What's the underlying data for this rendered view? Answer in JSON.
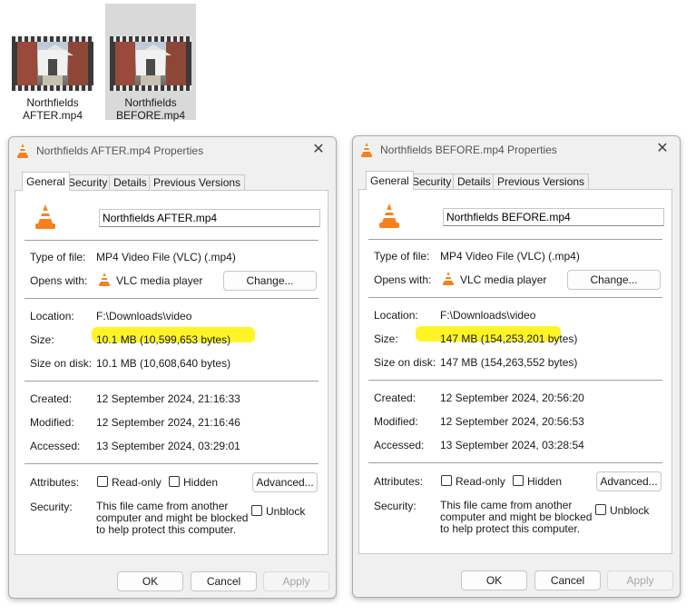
{
  "desktop": {
    "files": [
      {
        "line1": "Northfields",
        "line2": "AFTER.mp4",
        "selected": false
      },
      {
        "line1": "Northfields",
        "line2": "BEFORE.mp4",
        "selected": true
      }
    ]
  },
  "icons": {
    "vlc": "vlc-cone-icon",
    "thumbnail": "video-thumbnail-icon",
    "close": "close-icon"
  },
  "colors": {
    "highlight": "#fff200",
    "vlc_orange": "#f48120"
  },
  "labels": {
    "tabs": [
      "General",
      "Security",
      "Details",
      "Previous Versions"
    ],
    "type_of_file": "Type of file:",
    "opens_with": "Opens with:",
    "change": "Change...",
    "location": "Location:",
    "size": "Size:",
    "size_on_disk": "Size on disk:",
    "created": "Created:",
    "modified": "Modified:",
    "accessed": "Accessed:",
    "attributes": "Attributes:",
    "read_only": "Read-only",
    "hidden": "Hidden",
    "advanced": "Advanced...",
    "security": "Security:",
    "security_text": "This file came from another computer and might be blocked to help protect this computer.",
    "unblock": "Unblock",
    "ok": "OK",
    "cancel": "Cancel",
    "apply": "Apply"
  },
  "dialogs": [
    {
      "title": "Northfields AFTER.mp4 Properties",
      "filename": "Northfields AFTER.mp4",
      "type_of_file": "MP4 Video File (VLC) (.mp4)",
      "opens_with": "VLC media player",
      "location": "F:\\Downloads\\video",
      "size": "10.1 MB (10,599,653 bytes)",
      "size_on_disk": "10.1 MB (10,608,640 bytes)",
      "created": "12 September 2024, 21:16:33",
      "modified": "12 September 2024, 21:16:46",
      "accessed": "13 September 2024, 03:29:01"
    },
    {
      "title": "Northfields BEFORE.mp4 Properties",
      "filename": "Northfields BEFORE.mp4",
      "type_of_file": "MP4 Video File (VLC) (.mp4)",
      "opens_with": "VLC media player",
      "location": "F:\\Downloads\\video",
      "size": "147 MB (154,253,201 bytes)",
      "size_on_disk": "147 MB (154,263,552 bytes)",
      "created": "12 September 2024, 20:56:20",
      "modified": "12 September 2024, 20:56:53",
      "accessed": "13 September 2024, 03:28:54"
    }
  ]
}
